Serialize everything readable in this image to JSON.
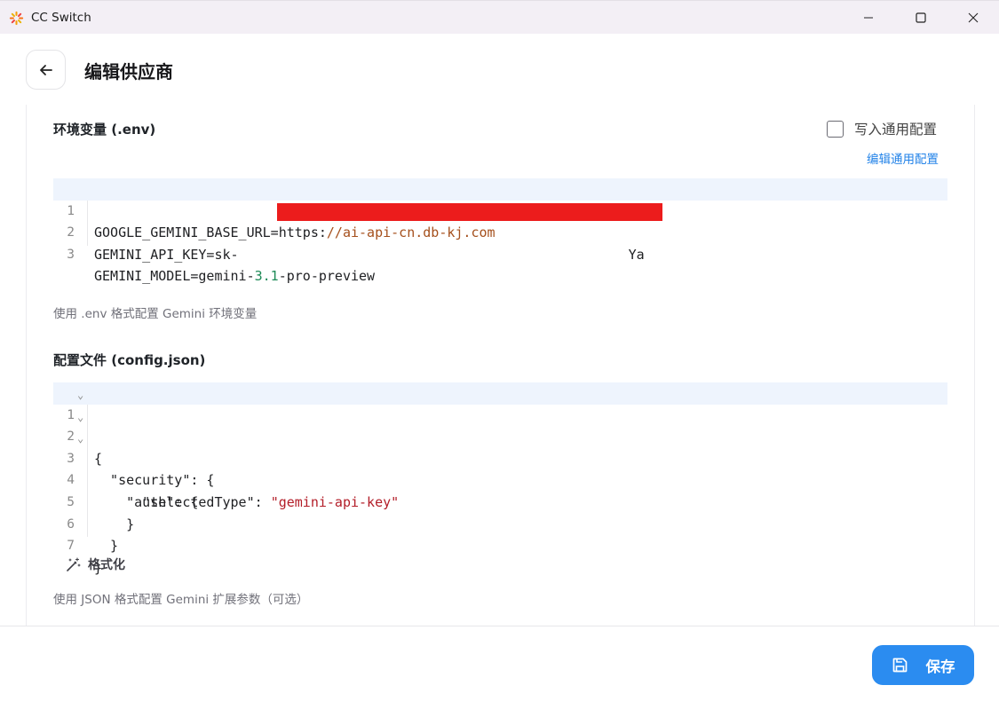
{
  "window": {
    "title": "CC Switch"
  },
  "header": {
    "title": "编辑供应商"
  },
  "env_section": {
    "title": "环境变量 (.env)",
    "checkbox_label": "写入通用配置",
    "checkbox_checked": false,
    "edit_link": "编辑通用配置",
    "lines": [
      {
        "n": "1",
        "key": "GOOGLE_GEMINI_BASE_URL=https:",
        "value": "//ai-api-cn.db-kj.com"
      },
      {
        "n": "2",
        "key": "GEMINI_API_KEY=sk-",
        "tail": "Ya"
      },
      {
        "n": "3",
        "key": "GEMINI_MODEL=gemini-",
        "num": "3.1",
        "rest": "-pro-preview"
      }
    ],
    "hint": "使用 .env 格式配置 Gemini 环境变量"
  },
  "config_section": {
    "title": "配置文件 (config.json)",
    "lines": [
      {
        "n": "1",
        "text": "{"
      },
      {
        "n": "2",
        "text": "  \"security\": {"
      },
      {
        "n": "3",
        "text": "    \"auth\": {"
      },
      {
        "n": "4",
        "key": "      \"selectedType\": ",
        "str": "\"gemini-api-key\""
      },
      {
        "n": "5",
        "text": "    }"
      },
      {
        "n": "6",
        "text": "  }"
      },
      {
        "n": "7",
        "text": "}"
      }
    ],
    "format_label": "格式化",
    "hint": "使用 JSON 格式配置 Gemini 扩展参数（可选）"
  },
  "footer": {
    "save_label": "保存"
  },
  "colors": {
    "accent": "#2b8cf0",
    "link": "#2383e8",
    "redaction": "#ec1c1c"
  }
}
